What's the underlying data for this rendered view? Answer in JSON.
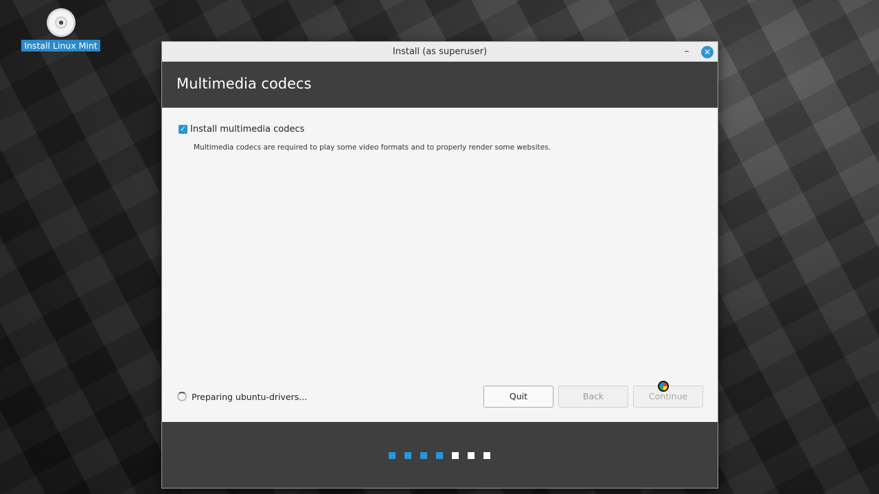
{
  "desktop": {
    "icon_label": "Install Linux Mint",
    "icon": "disc-icon"
  },
  "window": {
    "title": "Install (as superuser)",
    "minimize_glyph": "–",
    "close_glyph": "✕"
  },
  "page": {
    "title": "Multimedia codecs",
    "checkbox": {
      "label": "Install multimedia codecs",
      "checked": true,
      "description": "Multimedia codecs are required to play some video formats and to properly render some websites."
    }
  },
  "status": {
    "text": "Preparing ubuntu-drivers...",
    "icon": "spinner-icon"
  },
  "buttons": {
    "quit": "Quit",
    "back": "Back",
    "continue": "Continue"
  },
  "progress": {
    "total_steps": 7,
    "completed_steps": 4,
    "active_color": "#2b95d6",
    "inactive_color": "#ffffff"
  },
  "colors": {
    "accent": "#2b95d6",
    "header_bg": "#3f3f3f"
  }
}
